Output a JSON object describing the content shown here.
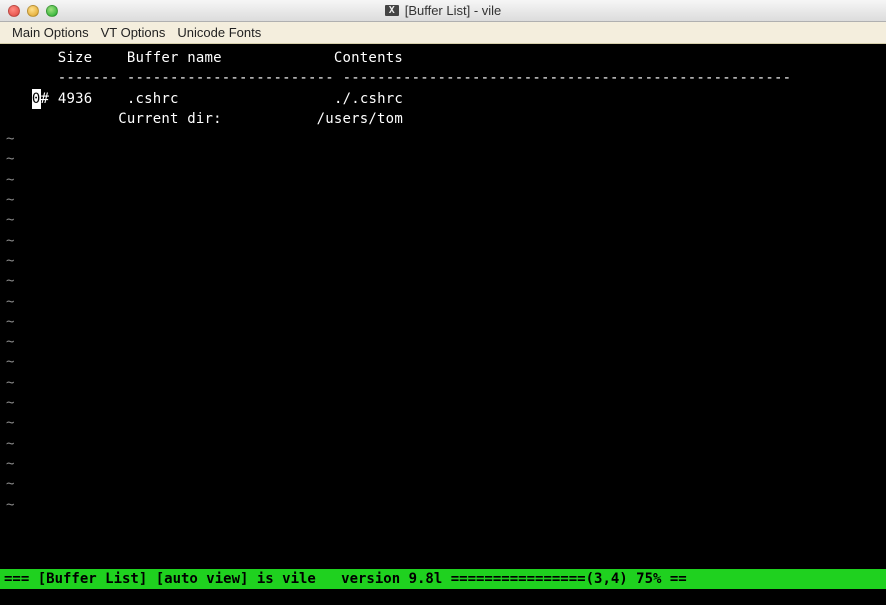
{
  "window": {
    "title": "[Buffer List] - vile"
  },
  "menus": {
    "main_options": "Main Options",
    "vt_options": "VT Options",
    "unicode_fonts": "Unicode Fonts"
  },
  "header": {
    "size": "Size",
    "buffer_name": "Buffer name",
    "contents": "Contents",
    "size_dash": "-------",
    "buffer_dash": "------------------------",
    "contents_dash": "----------------------------------------------------"
  },
  "row0": {
    "cursor": "0",
    "hash": "#",
    "size": "4936",
    "name": ".cshrc",
    "contents": "./.cshrc"
  },
  "curdir": {
    "label": "Current dir:",
    "value": "/users/tom"
  },
  "tilde": "~",
  "status": {
    "line": "=== [Buffer List] [auto view] is vile   version 9.8l ================(3,4) 75% =="
  }
}
